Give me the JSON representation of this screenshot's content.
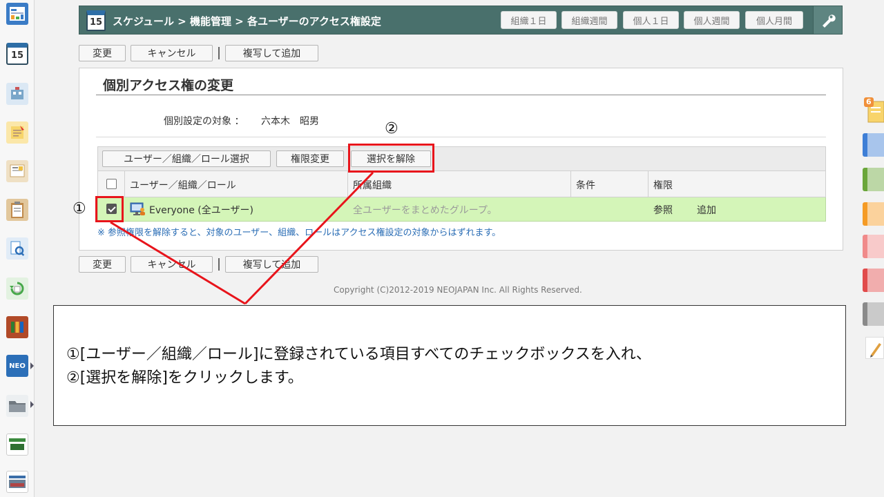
{
  "dock": {
    "items": [
      {
        "name": "portal-icon",
        "color": "#3b7cc6"
      },
      {
        "name": "schedule-icon",
        "color": "#2e6ea6",
        "text": "15"
      },
      {
        "name": "facility-icon",
        "color": "#7aa6c9"
      },
      {
        "name": "memo-icon",
        "color": "#f0b43a"
      },
      {
        "name": "bulletin-icon",
        "color": "#caa46a"
      },
      {
        "name": "todo-icon",
        "color": "#c08a4b"
      },
      {
        "name": "search-doc-icon",
        "color": "#4a8fd0"
      },
      {
        "name": "sync-icon",
        "color": "#47a84a"
      },
      {
        "name": "cabinet-icon",
        "color": "#b14a28"
      },
      {
        "name": "neo-chart-icon",
        "color": "#2c6fb8",
        "text": "NEO"
      },
      {
        "name": "folder-icon",
        "color": "#707880"
      },
      {
        "name": "banner-icon",
        "color": "#3b8a3e"
      },
      {
        "name": "photo-banner-icon",
        "color": "#6b7f95"
      }
    ]
  },
  "header": {
    "calendar_day": "15",
    "breadcrumb": "スケジュール > 機能管理 > 各ユーザーのアクセス権設定",
    "views": [
      "組織１日",
      "組織週間",
      "個人１日",
      "個人週間",
      "個人月間"
    ],
    "settings_icon": "wrench-icon"
  },
  "toolbar_top": {
    "change": "変更",
    "cancel": "キャンセル",
    "separator": "|",
    "copy_add": "複写して追加"
  },
  "panel": {
    "title": "個別アクセス権の変更",
    "target_label": "個別設定の対象 ：",
    "target_name": "六本木　昭男",
    "grid_toolbar": {
      "select_entity": "ユーザー／組織／ロール選択",
      "change_rights": "権限変更",
      "deselect": "選択を解除"
    },
    "columns": [
      "ユーザー／組織／ロール",
      "所属組織",
      "条件",
      "権限"
    ],
    "rows": [
      {
        "name": "Everyone (全ユーザー)",
        "org": "全ユーザーをまとめたグループ。",
        "condition": "",
        "rights": [
          "参照",
          "追加"
        ],
        "checked": true
      }
    ],
    "note": "※ 参照権限を解除すると、対象のユーザー、組織、ロールはアクセス権設定の対象からはずれます。"
  },
  "toolbar_bottom": {
    "change": "変更",
    "cancel": "キャンセル",
    "separator": "|",
    "copy_add": "複写して追加"
  },
  "copyright": "Copyright (C)2012-2019 NEOJAPAN Inc. All Rights Reserved.",
  "annotations": {
    "marker1": "①",
    "marker2": "②",
    "accent": "#e8141b"
  },
  "instruction": {
    "line1": "①[ユーザー／組織／ロール]に登録されている項目すべてのチェックボックスを入れ、",
    "line2": "②[選択を解除]をクリックします。"
  },
  "right_tabs": {
    "badge": "6",
    "colors": [
      "#3e7fd6",
      "#6aa63a",
      "#f59b25",
      "#f08a8a",
      "#e14b4b",
      "#8a8a8a"
    ]
  }
}
